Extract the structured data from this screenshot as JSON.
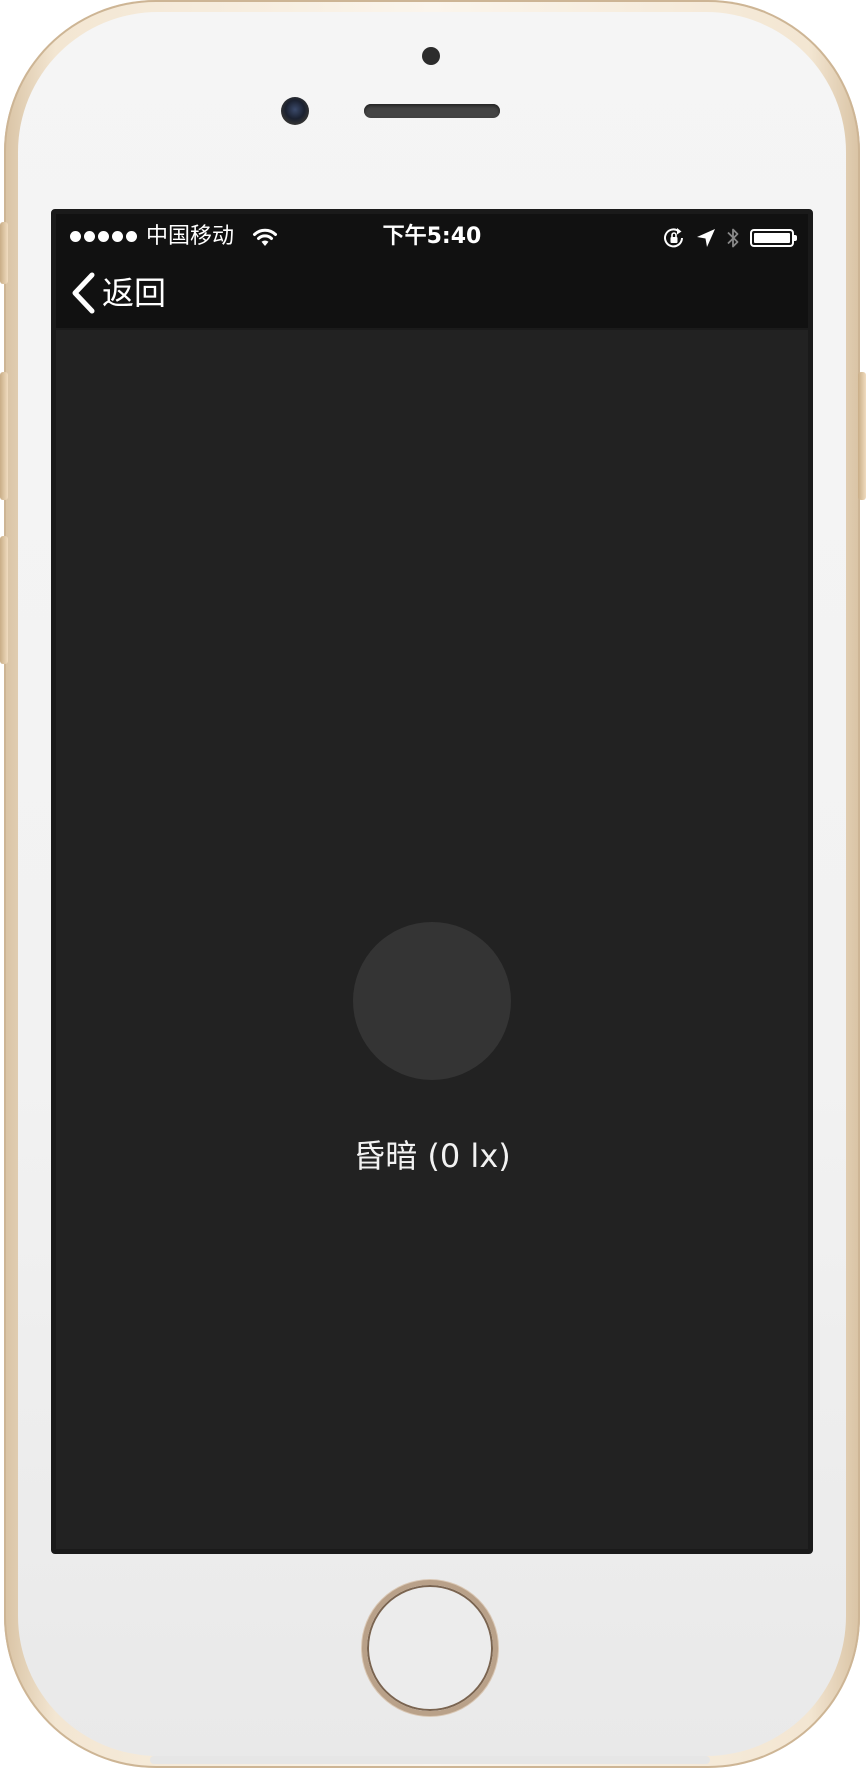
{
  "status_bar": {
    "carrier": "中国移动",
    "time": "下午5:40",
    "signal_bars": 5,
    "battery_level": 1.0,
    "icons": [
      "wifi-icon",
      "rotation-lock-icon",
      "location-arrow-icon",
      "bluetooth-icon",
      "battery-icon"
    ]
  },
  "nav_bar": {
    "back_label": "返回"
  },
  "sensor": {
    "reading": "昏暗 (0 lx)"
  },
  "colors": {
    "screen_bg": "#222222",
    "bar_bg": "#111111",
    "indicator": "#343434",
    "text": "#ffffff"
  }
}
